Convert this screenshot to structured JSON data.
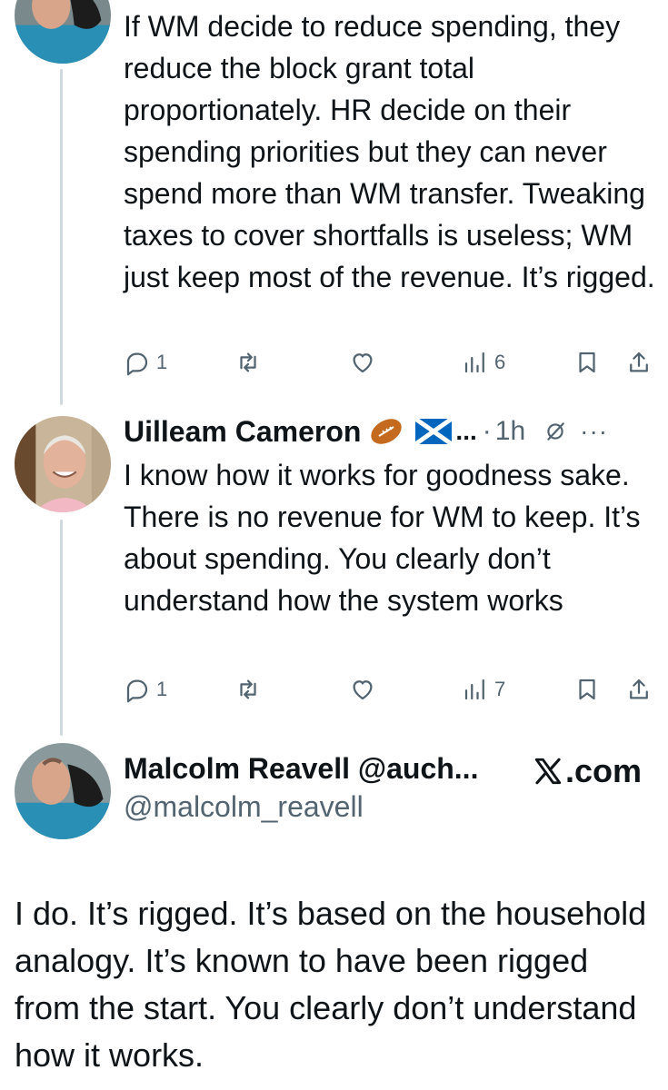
{
  "tweet_1": {
    "text": "If WM decide to reduce spending, they reduce the block grant total proportionately. HR decide on their spending priorities but they can never spend more than WM transfer. Tweaking taxes to cover shortfalls is useless; WM just keep most of the revenue. It’s rigged.",
    "reply_count": "1",
    "view_count": "6"
  },
  "tweet_2": {
    "author_name": "Uilleam Cameron",
    "name_suffix": "...",
    "separator": "·",
    "time": "1h",
    "text": "I know how it works for goodness sake. There is no revenue for WM to keep. It’s about spending. You clearly don’t understand how the system works",
    "reply_count": "1",
    "view_count": "7"
  },
  "quote_card": {
    "author_name": "Malcolm Reavell @auch...",
    "handle": "@malcolm_reavell",
    "source": ".com",
    "text": "I do. It’s rigged. It’s based on the household analogy. It’s known to have been rigged from the start. You clearly don’t understand how it works."
  },
  "icons": {
    "reply": "reply-icon",
    "retweet": "retweet-icon",
    "like": "heart-icon",
    "views": "views-icon",
    "bookmark": "bookmark-icon",
    "share": "share-icon",
    "grok": "grok-icon",
    "more": "more-icon",
    "emoji_1": "rugby-ball-icon",
    "emoji_2": "scotland-flag-icon",
    "brand": "x-logo-icon"
  },
  "colors": {
    "text": "#0f1419",
    "secondary": "#536471",
    "thread_line": "#cfd9de"
  }
}
